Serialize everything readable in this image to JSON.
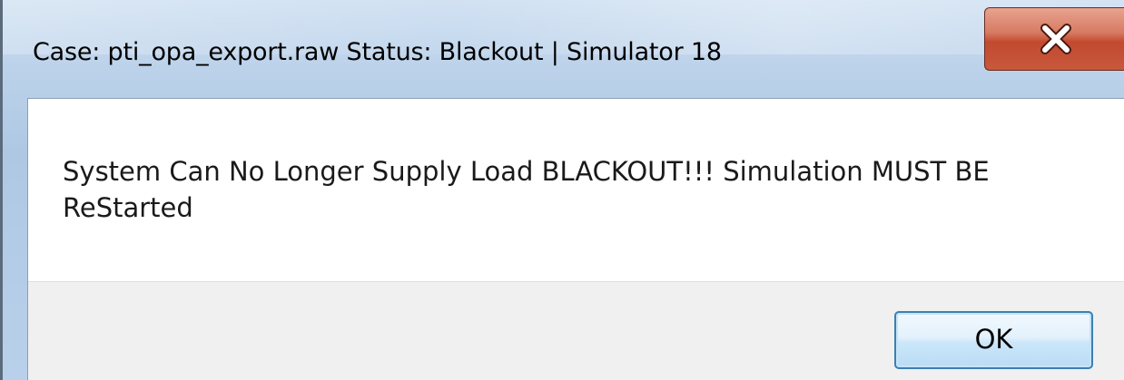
{
  "window": {
    "title": "Case: pti_opa_export.raw  Status: Blackout | Simulator 18",
    "close_icon": "close-icon"
  },
  "dialog": {
    "message": "System Can No Longer Supply Load BLACKOUT!!! Simulation MUST BE ReStarted",
    "ok_label": "OK"
  },
  "colors": {
    "titlebar": "#bcd2ea",
    "close_button": "#c14a2f",
    "client_background": "#ffffff",
    "button_area": "#f0f0f0",
    "ok_border": "#3c7fb1"
  }
}
